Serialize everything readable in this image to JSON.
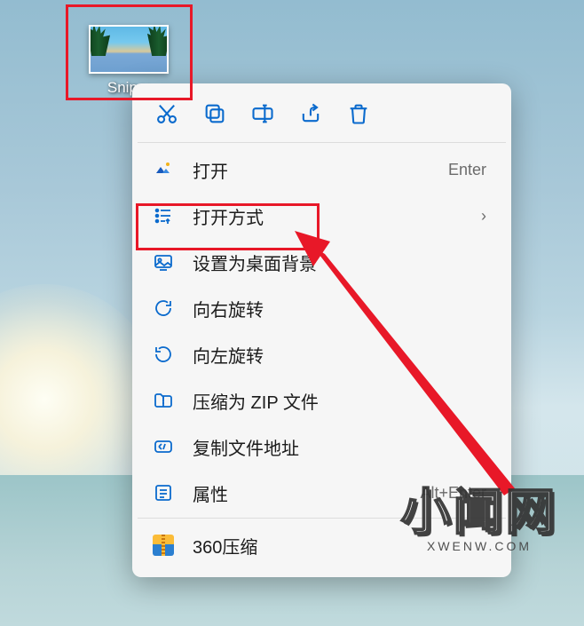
{
  "desktop": {
    "file_label": "Snipa:"
  },
  "toolbar": {
    "cut": "cut",
    "copy": "copy",
    "rename": "rename",
    "share": "share",
    "delete": "delete"
  },
  "menu": {
    "open": {
      "label": "打开",
      "shortcut": "Enter"
    },
    "open_with": {
      "label": "打开方式"
    },
    "set_background": {
      "label": "设置为桌面背景"
    },
    "rotate_right": {
      "label": "向右旋转"
    },
    "rotate_left": {
      "label": "向左旋转"
    },
    "compress_zip": {
      "label": "压缩为 ZIP 文件"
    },
    "copy_path": {
      "label": "复制文件地址"
    },
    "properties": {
      "label": "属性",
      "shortcut": "Alt+Enter"
    },
    "zip360": {
      "label": "360压缩"
    }
  },
  "watermark": {
    "title": "小闻网",
    "sub": "XWENW.COM"
  }
}
